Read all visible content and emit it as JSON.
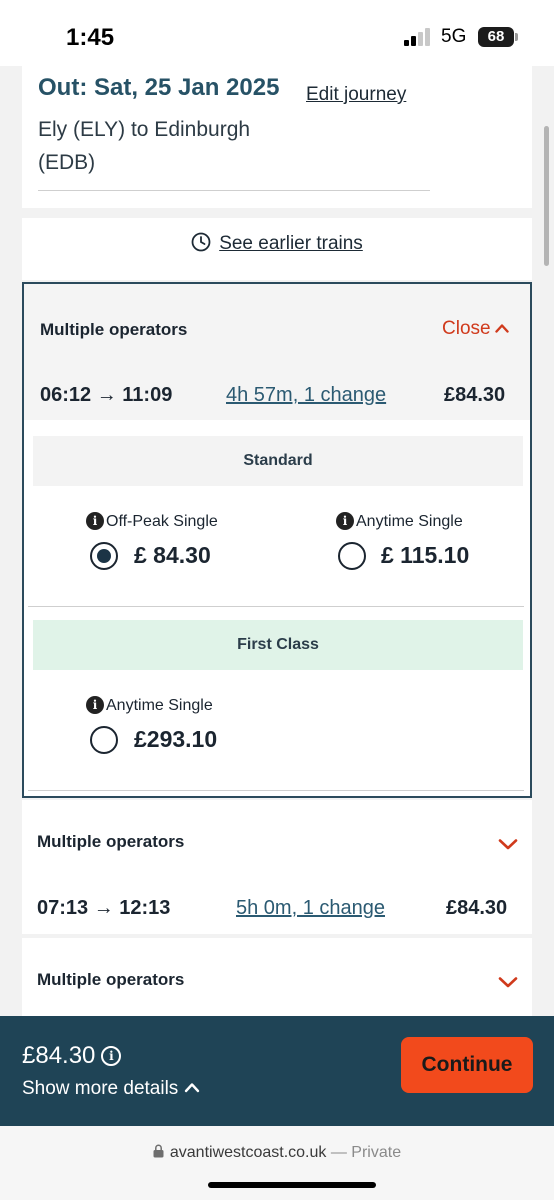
{
  "status_bar": {
    "time": "1:45",
    "network": "5G",
    "battery": "68"
  },
  "summary": {
    "out_label": "Out: Sat, 25 Jan 2025",
    "edit_label": "Edit journey",
    "route": "Ely (ELY) to Edinburgh (EDB)"
  },
  "earlier": {
    "label": "See earlier trains"
  },
  "expanded_journey": {
    "operator": "Multiple operators",
    "close_label": "Close",
    "times": "06:12 → 11:09",
    "duration": "4h 57m, 1 change",
    "price": "£84.30",
    "standard": {
      "label": "Standard",
      "fares": [
        {
          "name": "Off-Peak Single",
          "price": "£ 84.30",
          "selected": true
        },
        {
          "name": "Anytime Single",
          "price": "£ 115.10",
          "selected": false
        }
      ]
    },
    "first_class": {
      "label": "First Class",
      "fares": [
        {
          "name": "Anytime Single",
          "price": "£293.10",
          "selected": false
        }
      ]
    }
  },
  "journeys": [
    {
      "operator": "Multiple operators",
      "times": "07:13 → 12:13",
      "duration": "5h 0m, 1 change",
      "price": "£84.30"
    },
    {
      "operator": "Multiple operators"
    }
  ],
  "footer": {
    "total": "£84.30",
    "more_details": "Show more details",
    "continue_label": "Continue"
  },
  "browser": {
    "domain": "avantiwestcoast.co.uk",
    "private_label": "— Private"
  },
  "colors": {
    "accent": "#d03a1c",
    "continue_bg": "#f24a1c",
    "footer_bg": "#1f4456",
    "heading": "#275266",
    "first_class_bg": "#e0f3e8"
  }
}
